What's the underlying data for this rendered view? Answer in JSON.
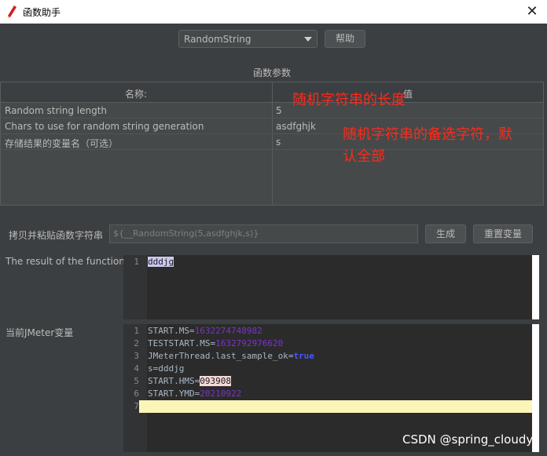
{
  "window": {
    "title": "函数助手",
    "close_glyph": "✕",
    "app_icon": "pencil-icon"
  },
  "function_select": {
    "selected": "RandomString"
  },
  "help_button": "帮助",
  "params": {
    "section_title": "函数参数",
    "columns": [
      "名称:",
      "值"
    ],
    "rows": [
      {
        "name": "Random string length",
        "value": "5"
      },
      {
        "name": "Chars to use for random string generation",
        "value": "asdfghjk"
      },
      {
        "name": "存储结果的变量名（可选）",
        "value": "s"
      }
    ]
  },
  "annotations": {
    "length_note": "随机字符串的长度",
    "chars_note_line1": "随机字符串的备选字符，默",
    "chars_note_line2": "认全部"
  },
  "copy_paste": {
    "label": "拷贝并粘贴函数字符串",
    "value": "${__RandomString(5,asdfghjk,s)}",
    "generate_button": "生成",
    "reset_button": "重置变量"
  },
  "result": {
    "label": "The result of the function is",
    "lines": [
      {
        "n": "1",
        "text": "dddjg"
      }
    ]
  },
  "variables": {
    "label": "当前JMeter变量",
    "lines": [
      {
        "n": "1",
        "key": "START.MS",
        "sep": "=",
        "val": "1632274748982"
      },
      {
        "n": "2",
        "key": "TESTSTART.MS",
        "sep": "=",
        "val": "1632792976620"
      },
      {
        "n": "3",
        "key": "JMeterThread.last_sample_ok",
        "sep": "=",
        "val": "true"
      },
      {
        "n": "4",
        "key": "s",
        "sep": "=",
        "val": "dddjg"
      },
      {
        "n": "5",
        "key": "START.HMS",
        "sep": "=",
        "val": "093908"
      },
      {
        "n": "6",
        "key": "START.YMD",
        "sep": "=",
        "val": "20210922"
      },
      {
        "n": "7",
        "key": "",
        "sep": "",
        "val": ""
      }
    ]
  },
  "watermark": "CSDN @spring_cloudy",
  "colors": {
    "annotation": "#ff2a1a",
    "current_line": "#fbf5b8",
    "keyword": "#4a55ff",
    "number": "#7a34c8"
  }
}
